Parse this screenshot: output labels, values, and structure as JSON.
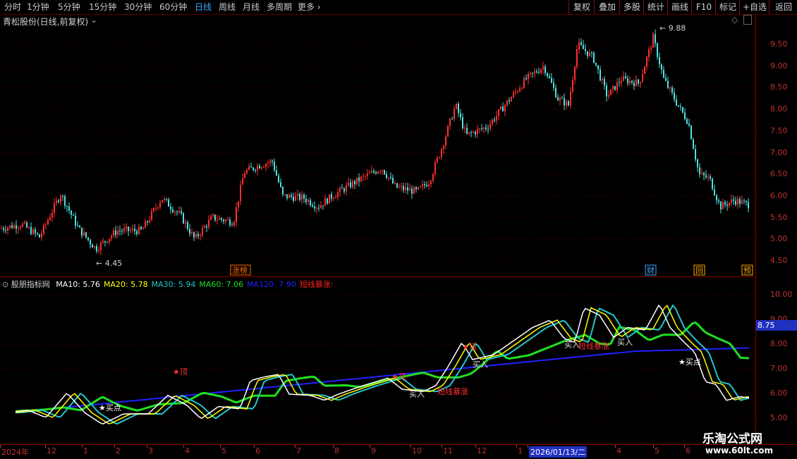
{
  "toolbar": {
    "periods": [
      "分时",
      "1分钟",
      "5分钟",
      "15分钟",
      "30分钟",
      "60分钟",
      "日线",
      "周线",
      "月线",
      "多周期",
      "更多"
    ],
    "active": "日线",
    "right_buttons": [
      "复权",
      "叠加",
      "多股",
      "统计",
      "画线",
      "F10",
      "标记",
      "+自选",
      "返回"
    ]
  },
  "price_panel": {
    "stock_title": "青松股份(日线,前复权)",
    "axis_ticks": [
      "9.50",
      "9.00",
      "8.50",
      "8.00",
      "7.50",
      "7.00",
      "6.50",
      "6.00",
      "5.50",
      "5.00",
      "4.50"
    ],
    "high_label": "9.88",
    "low_label": "4.45",
    "badges": [
      {
        "text": "涨榜",
        "color": "#ff6a00"
      },
      {
        "text": "财",
        "color": "#3fa7ff"
      },
      {
        "text": "回",
        "color": "#ffaa00"
      },
      {
        "text": "预",
        "color": "#ffaa00"
      }
    ]
  },
  "indicator_panel": {
    "name": "股朋指标网",
    "ma_items": [
      {
        "label": "MA10: 5.76",
        "color": "#ffffff"
      },
      {
        "label": "MA20: 5.78",
        "color": "#ffff00"
      },
      {
        "label": "MA30: 5.94",
        "color": "#20c8c8"
      },
      {
        "label": "MA60: 7.06",
        "color": "#20e020"
      },
      {
        "label": "MA120: 7.90",
        "color": "#2020ff"
      },
      {
        "label": "短线暴涨:",
        "color": "#ff2020"
      }
    ],
    "axis_ticks": [
      "10.00",
      "9.00",
      "8.00",
      "7.00",
      "6.00",
      "5.00"
    ],
    "current_value": "8.75",
    "signals": [
      "★顶",
      "★顶",
      "★顶",
      "买入",
      "买入",
      "买入",
      "买入",
      "短线暴涨",
      "短线暴涨",
      "★买点",
      "★买点"
    ]
  },
  "date_axis": {
    "labels": [
      "2024年",
      "12",
      "1",
      "2",
      "3",
      "4",
      "5",
      "6",
      "7",
      "8",
      "9",
      "10",
      "11",
      "12",
      "1",
      "2026/01/13/二",
      "4",
      "5",
      "6"
    ]
  },
  "watermark": {
    "line1": "乐淘公式网",
    "line2": "www.60lt.com"
  },
  "colors": {
    "up": "#ff3030",
    "down": "#50e0e0",
    "grid": "#7a0000",
    "axis": "#c03030"
  }
}
